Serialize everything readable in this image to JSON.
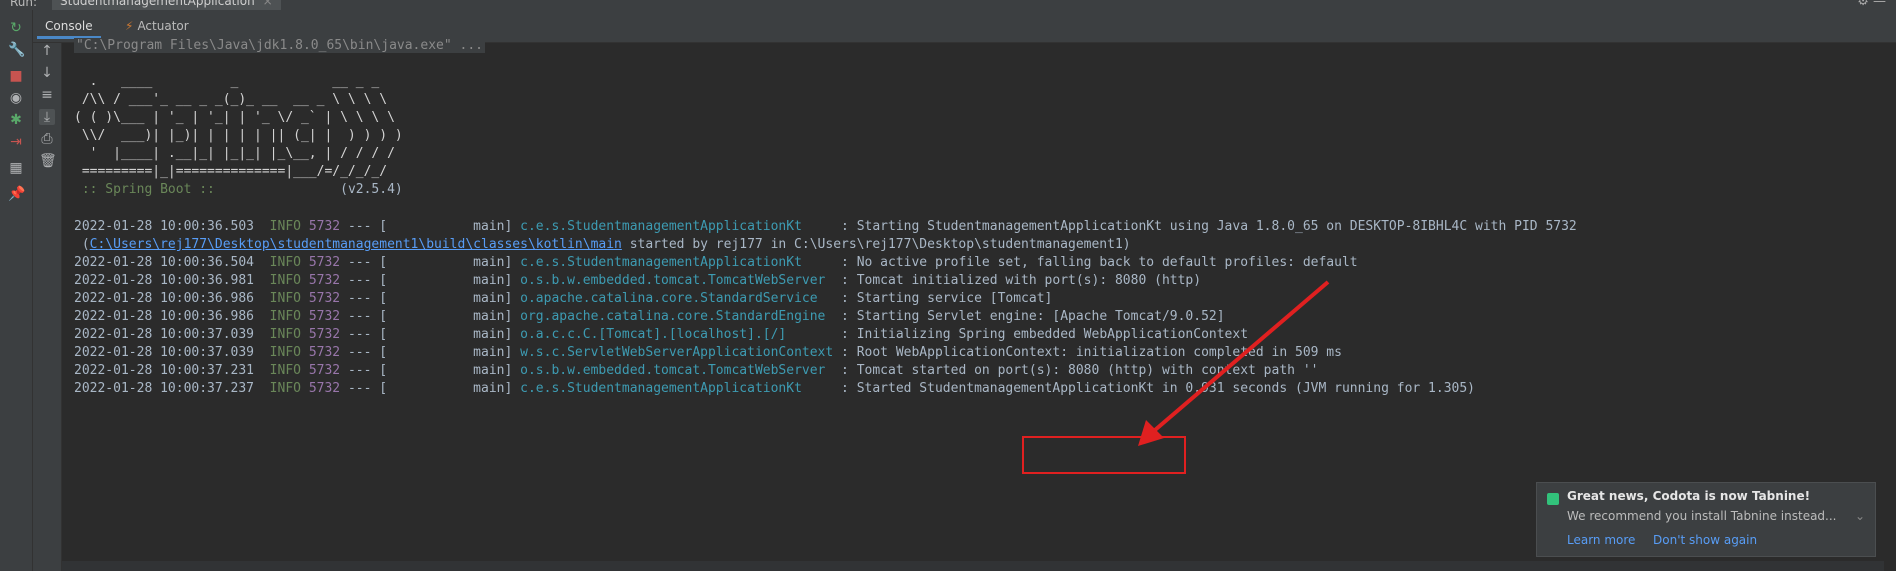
{
  "runbar": {
    "label": "Run:",
    "tab": "StudentmanagementApplication",
    "tab_close": "×",
    "settings_icon": "gear-icon",
    "minimize_icon": "minimize-icon"
  },
  "tabs": [
    {
      "label": "Console",
      "icon": ""
    },
    {
      "label": "Actuator",
      "icon": "actuator-icon"
    }
  ],
  "console": {
    "command": "\"C:\\Program Files\\Java\\jdk1.8.0_65\\bin\\java.exe\" ...",
    "banner": [
      "  .   ____          _            __ _ _",
      " /\\\\ / ___'_ __ _ _(_)_ __  __ _ \\ \\ \\ \\",
      "( ( )\\___ | '_ | '_| | '_ \\/ _` | \\ \\ \\ \\",
      " \\\\/  ___)| |_)| | | | | || (_| |  ) ) ) )",
      "  '  |____| .__|_| |_|_| |_\\__, | / / / /",
      " =========|_|==============|___/=/_/_/_/"
    ],
    "spring_label": " :: Spring Boot :: ",
    "spring_version": "               (v2.5.4)",
    "logs": [
      {
        "ts": "2022-01-28 10:00:36.503",
        "level": "INFO",
        "pid": "5732",
        "thread": " --- [           main] ",
        "logger": "c.e.s.StudentmanagementApplicationKt    ",
        "msg": " : Starting StudentmanagementApplicationKt using Java 1.8.0_65 on DESKTOP-8IBHL4C with PID 5732"
      },
      {
        "ts": "2022-01-28 10:00:36.504",
        "level": "INFO",
        "pid": "5732",
        "thread": " --- [           main] ",
        "logger": "c.e.s.StudentmanagementApplicationKt    ",
        "msg": " : No active profile set, falling back to default profiles: default"
      },
      {
        "ts": "2022-01-28 10:00:36.981",
        "level": "INFO",
        "pid": "5732",
        "thread": " --- [           main] ",
        "logger": "o.s.b.w.embedded.tomcat.TomcatWebServer ",
        "msg": " : Tomcat initialized with port(s): 8080 (http)"
      },
      {
        "ts": "2022-01-28 10:00:36.986",
        "level": "INFO",
        "pid": "5732",
        "thread": " --- [           main] ",
        "logger": "o.apache.catalina.core.StandardService  ",
        "msg": " : Starting service [Tomcat]"
      },
      {
        "ts": "2022-01-28 10:00:36.986",
        "level": "INFO",
        "pid": "5732",
        "thread": " --- [           main] ",
        "logger": "org.apache.catalina.core.StandardEngine ",
        "msg": " : Starting Servlet engine: [Apache Tomcat/9.0.52]"
      },
      {
        "ts": "2022-01-28 10:00:37.039",
        "level": "INFO",
        "pid": "5732",
        "thread": " --- [           main] ",
        "logger": "o.a.c.c.C.[Tomcat].[localhost].[/]      ",
        "msg": " : Initializing Spring embedded WebApplicationContext"
      },
      {
        "ts": "2022-01-28 10:00:37.039",
        "level": "INFO",
        "pid": "5732",
        "thread": " --- [           main] ",
        "logger": "w.s.c.ServletWebServerApplicationContext",
        "msg": " : Root WebApplicationContext: initialization completed in 509 ms"
      },
      {
        "ts": "2022-01-28 10:00:37.231",
        "level": "INFO",
        "pid": "5732",
        "thread": " --- [           main] ",
        "logger": "o.s.b.w.embedded.tomcat.TomcatWebServer ",
        "msg": " : Tomcat started on port(s): 8080 (http) with context path ''"
      },
      {
        "ts": "2022-01-28 10:00:37.237",
        "level": "INFO",
        "pid": "5732",
        "thread": " --- [           main] ",
        "logger": "c.e.s.StudentmanagementApplicationKt    ",
        "msg": " : Started StudentmanagementApplicationKt in 0.931 seconds (JVM running for 1.305)"
      }
    ],
    "continuation": {
      "open": " (",
      "link": "C:\\Users\\rej177\\Desktop\\studentmanagement1\\build\\classes\\kotlin\\main",
      "rest": " started by rej177 in C:\\Users\\rej177\\Desktop\\studentmanagement1)"
    }
  },
  "notification": {
    "title": "Great news, Codota is now Tabnine!",
    "body": "We recommend you install Tabnine instead...",
    "link1": "Learn more",
    "link2": "Don't show again"
  },
  "colors": {
    "background": "#2b2b2b",
    "info": "#6a8759",
    "pid": "#9876aa",
    "logger": "#3d9bb2",
    "annotation": "#e02020"
  }
}
